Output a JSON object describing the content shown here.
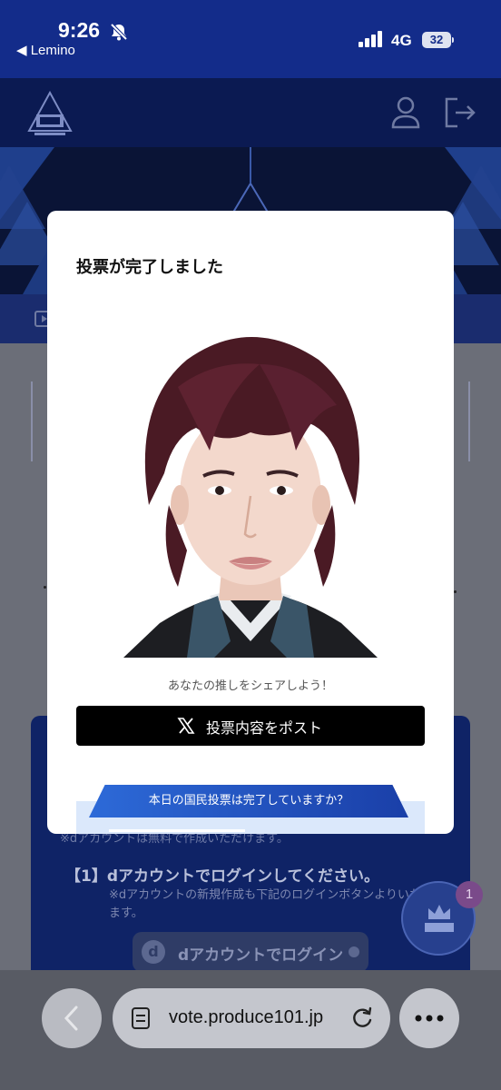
{
  "status_bar": {
    "time": "9:26",
    "back_app": "◀ Lemino",
    "network": "4G",
    "battery": "32"
  },
  "modal": {
    "title": "投票が完了しました",
    "share_prompt": "あなたの推しをシェアしよう！",
    "post_button": "投票内容をポスト",
    "vote_check_banner": "本日の国民投票は完了していますか？"
  },
  "background_page": {
    "note": "※dアカウントは無料で作成いただけます。",
    "step1": "【1】dアカウントでログインしてください。",
    "step1_sub": "※dアカウントの新規作成も下記のログインボタンよりいただけます。",
    "login_button": "dアカウントでログイン",
    "fab_badge": "1"
  },
  "browser": {
    "url": "vote.produce101.jp"
  },
  "colors": {
    "status_bar_bg": "#132c8a",
    "header_bg": "#0b1a52",
    "post_button_bg": "#000000",
    "banner_blue": "#2d6ad8"
  }
}
